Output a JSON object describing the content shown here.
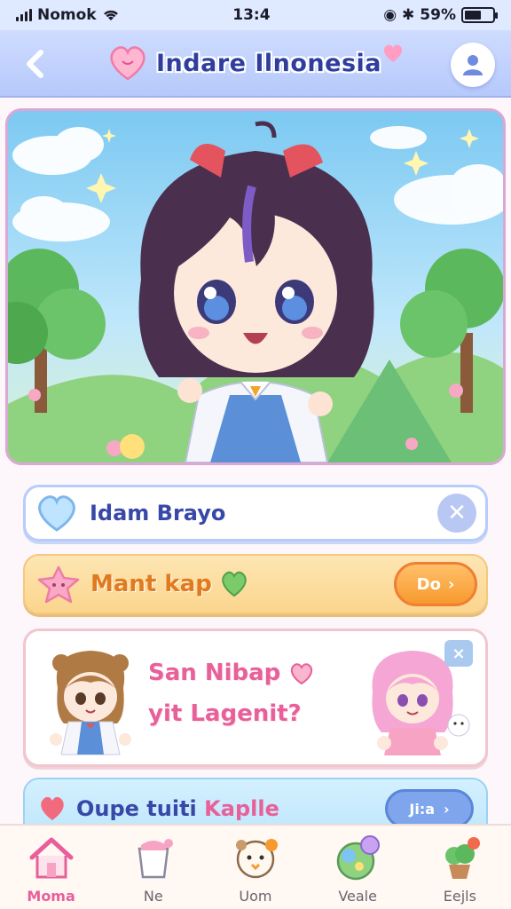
{
  "status_bar": {
    "carrier": "Nomok",
    "time": "13:4",
    "battery_percent": "59%",
    "battery_level": 0.59
  },
  "header": {
    "title": "Indare Ilnonesia",
    "back_icon": "chevron-left-icon",
    "profile_icon": "person-icon"
  },
  "hero": {
    "image": "anime-girl-character-illustration"
  },
  "search": {
    "value": "Idam Brayo",
    "clear_icon": "close-icon"
  },
  "banner": {
    "text": "Mant kap",
    "button_label": "Do"
  },
  "promo": {
    "line1": "San Nibap",
    "line2": "yit Lagenit?",
    "close_label": "×"
  },
  "bottom_card": {
    "text_a": "Oupe tuiti",
    "text_b": "Kaplle",
    "button_label": "Ji:a"
  },
  "tabs": [
    {
      "label": "Moma",
      "icon": "home-icon",
      "active": true
    },
    {
      "label": "Ne",
      "icon": "shopping-bag-icon",
      "active": false
    },
    {
      "label": "Uom",
      "icon": "face-icon",
      "active": false
    },
    {
      "label": "Veale",
      "icon": "ball-icon",
      "active": false
    },
    {
      "label": "Eejls",
      "icon": "plant-icon",
      "active": false
    }
  ],
  "colors": {
    "header_bg": "#b6c9fb",
    "title_text": "#2f3e9e",
    "accent_pink": "#e8609a",
    "accent_orange": "#f79a2e"
  }
}
